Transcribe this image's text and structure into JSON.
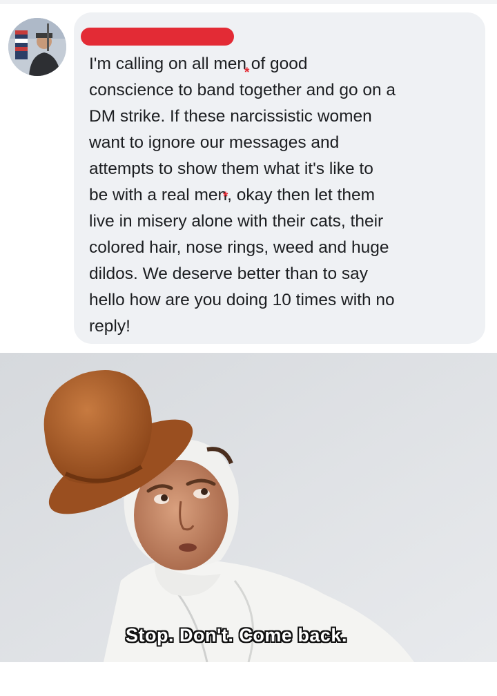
{
  "comment": {
    "author_redacted": true,
    "text_lines": [
      "I'm calling on all men of good",
      "conscience to band together and go on a",
      "DM strike. If these narcissistic women",
      "want to ignore our messages and",
      "attempts to show them what it's like to",
      "be with a real men, okay then let them",
      "live in misery alone with their cats, their",
      "colored hair, nose rings, weed and huge",
      "dildos. We deserve better than to say",
      "hello how are you doing 10 times with no",
      "reply!"
    ],
    "censor_mark": "*",
    "colors": {
      "bubble": "#eff1f4",
      "redaction": "#e32b35",
      "text": "#1c1e21"
    }
  },
  "meme": {
    "caption": "Stop. Don't. Come back.",
    "caption_color": "#ffffff",
    "caption_outline": "#111111"
  }
}
